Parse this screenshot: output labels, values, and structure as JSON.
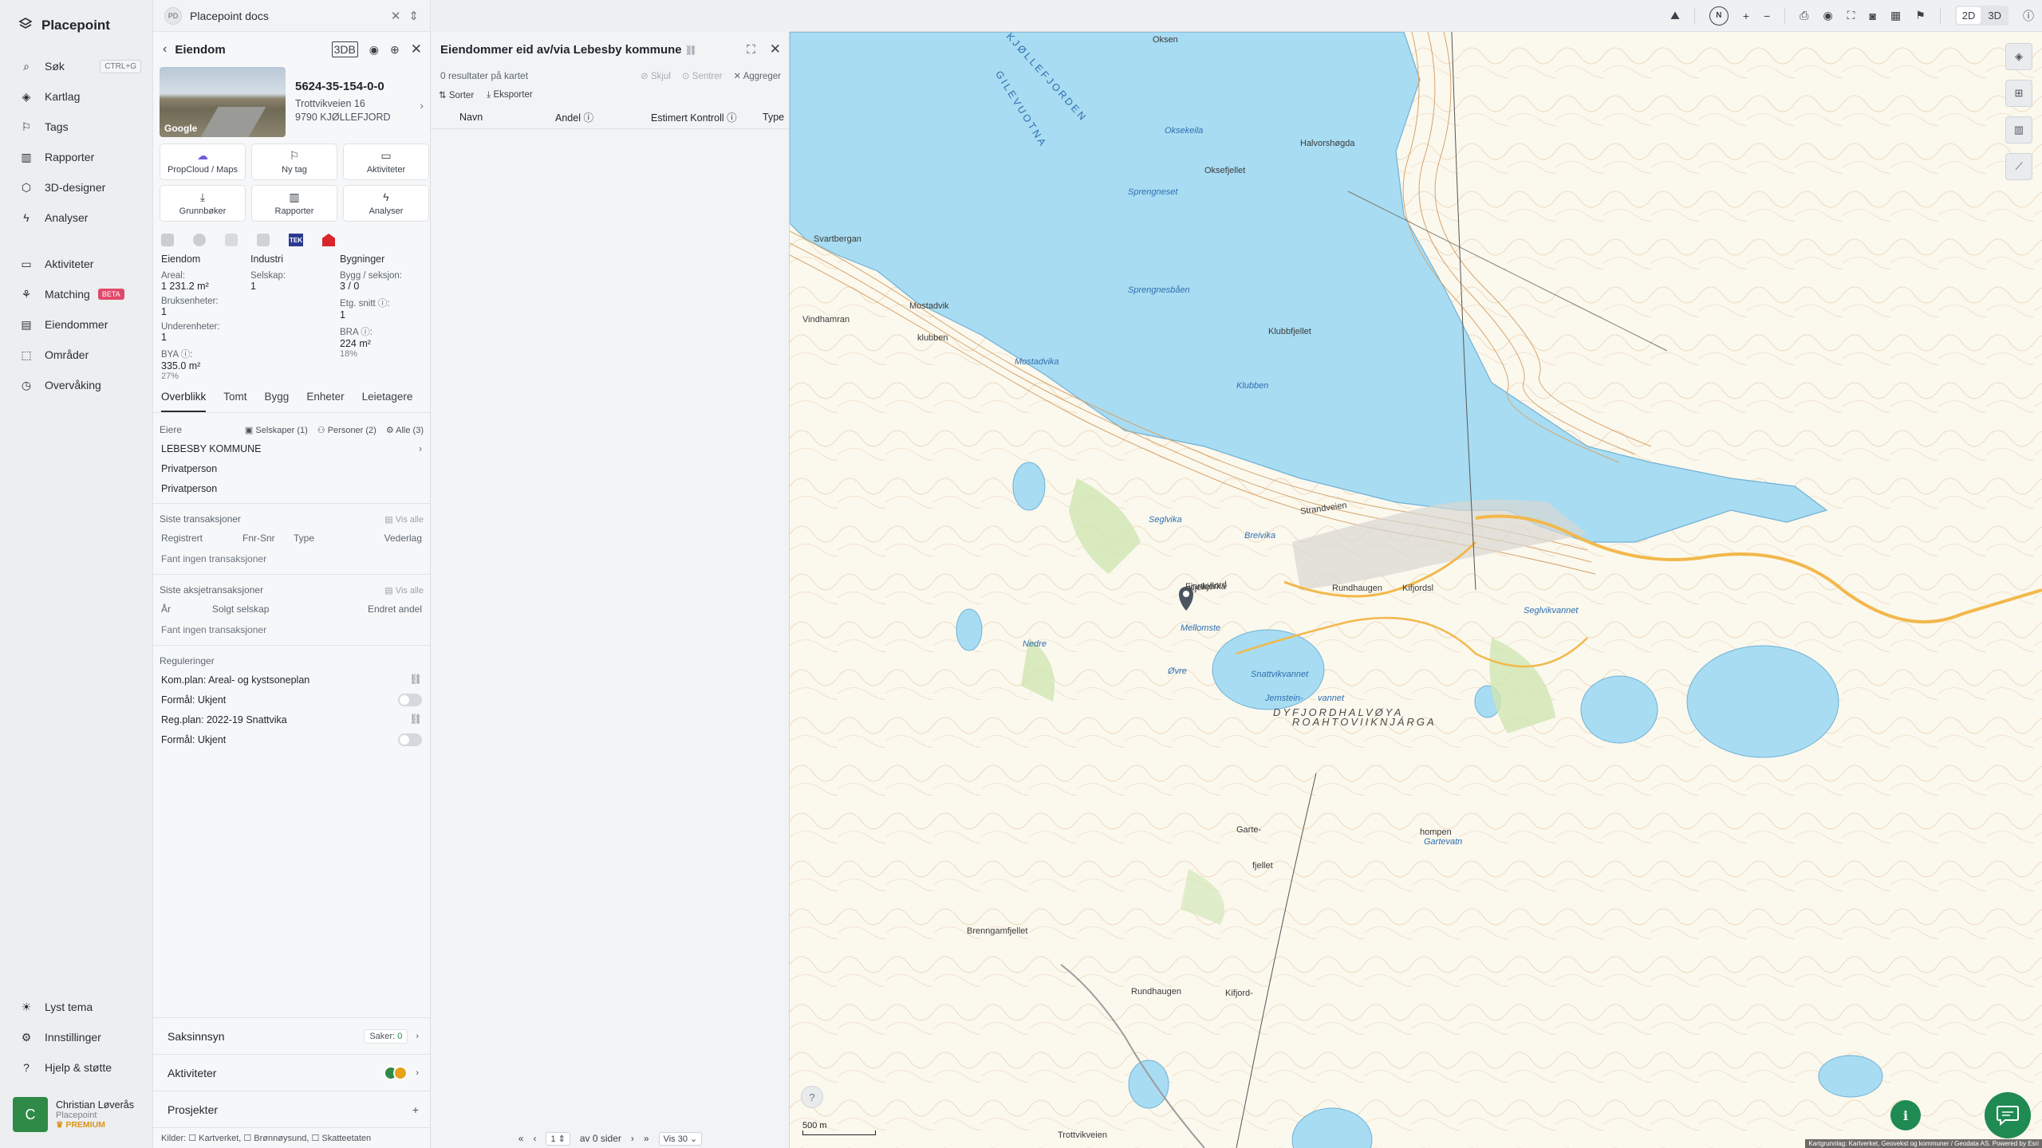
{
  "app": {
    "brand": "Placepoint"
  },
  "nav": {
    "items": [
      {
        "label": "Søk",
        "shortcut": "CTRL+G",
        "icon": "search-icon"
      },
      {
        "label": "Kartlag",
        "icon": "layers-icon"
      },
      {
        "label": "Tags",
        "icon": "bookmark-icon"
      },
      {
        "label": "Rapporter",
        "icon": "chart-icon"
      },
      {
        "label": "3D-designer",
        "icon": "cube-icon"
      },
      {
        "label": "Analyser",
        "icon": "bolt-icon"
      }
    ],
    "items2": [
      {
        "label": "Aktiviteter",
        "icon": "chat-icon"
      },
      {
        "label": "Matching",
        "badge": "BETA",
        "icon": "handshake-icon"
      },
      {
        "label": "Eiendommer",
        "icon": "book-icon"
      },
      {
        "label": "Områder",
        "icon": "area-icon"
      },
      {
        "label": "Overvåking",
        "icon": "clock-icon"
      }
    ],
    "bottom": [
      {
        "label": "Lyst tema",
        "icon": "sun-icon"
      },
      {
        "label": "Innstillinger",
        "icon": "gear-icon"
      },
      {
        "label": "Hjelp & støtte",
        "icon": "help-icon"
      }
    ],
    "user": {
      "initial": "C",
      "name": "Christian Løverås",
      "org": "Placepoint",
      "tier": "PREMIUM"
    }
  },
  "tab": {
    "badge": "PD",
    "title": "Placepoint docs"
  },
  "eiendom": {
    "title": "Eiendom",
    "badge_3d": "3DB",
    "id": "5624-35-154-0-0",
    "address1": "Trottvikveien 16",
    "address2": "9790 KJØLLEFJORD",
    "street_view_label": "Google",
    "actions": [
      {
        "label": "PropCloud / Maps",
        "icon": "cloud-icon"
      },
      {
        "label": "Ny tag",
        "icon": "bookmark-icon"
      },
      {
        "label": "Aktiviteter",
        "icon": "chat-icon"
      },
      {
        "label": "Grunnbøker",
        "icon": "download-icon"
      },
      {
        "label": "Rapporter",
        "icon": "chart-icon"
      },
      {
        "label": "Analyser",
        "icon": "bolt-icon"
      }
    ],
    "source_tek": "TEK",
    "stats": {
      "col1_head": "Eiendom",
      "col2_head": "Industri",
      "col3_head": "Bygninger",
      "areal_label": "Areal:",
      "areal_value": "1 231.2 m²",
      "bruksenheter_label": "Bruksenheter:",
      "bruksenheter_value": "1",
      "underenheter_label": "Underenheter:",
      "underenheter_value": "1",
      "bya_label": "BYA ⓘ:",
      "bya_value": "335.0 m²",
      "bya_pct": "27%",
      "selskap_label": "Selskap:",
      "selskap_value": "1",
      "bygg_label": "Bygg / seksjon:",
      "bygg_value": "3 / 0",
      "etg_label": "Etg. snitt ⓘ:",
      "etg_value": "1",
      "bra_label": "BRA ⓘ:",
      "bra_value": "224 m²",
      "bra_pct": "18%"
    },
    "subtabs": [
      "Overblikk",
      "Tomt",
      "Bygg",
      "Enheter",
      "Leietagere"
    ],
    "owners": {
      "label": "Eiere",
      "filters": [
        "Selskaper (1)",
        "Personer (2)",
        "Alle (3)"
      ],
      "list": [
        "LEBESBY KOMMUNE",
        "Privatperson",
        "Privatperson"
      ]
    },
    "transactions": {
      "label": "Siste transaksjoner",
      "show_all": "Vis alle",
      "cols": [
        "Registrert",
        "Fnr-Snr",
        "Type",
        "Vederlag"
      ],
      "empty": "Fant ingen transaksjoner"
    },
    "share_transactions": {
      "label": "Siste aksjetransaksjoner",
      "show_all": "Vis alle",
      "cols": [
        "År",
        "Solgt selskap",
        "Endret andel"
      ],
      "empty": "Fant ingen transaksjoner"
    },
    "regulations": {
      "label": "Reguleringer",
      "rows": [
        "Kom.plan: Areal- og kystsoneplan",
        "Formål: Ukjent",
        "Reg.plan: 2022-19 Snattvika",
        "Formål: Ukjent"
      ]
    },
    "footer": {
      "saksinnsyn": "Saksinnsyn",
      "saker_label": "Saker:",
      "saker_value": "0",
      "aktiviteter": "Aktiviteter",
      "prosjekter": "Prosjekter",
      "kilder": "Kilder: ☐ Kartverket, ☐ Brønnøysund, ☐ Skatteetaten"
    }
  },
  "owned": {
    "title": "Eiendommer eid av/via Lebesby kommune",
    "results": "0 resultater på kartet",
    "skjul": "Skjul",
    "sentrer": "Sentrer",
    "aggreger": "Aggreger",
    "sorter": "Sorter",
    "eksporter": "Eksporter",
    "cols": [
      "Navn",
      "Andel ⓘ",
      "Estimert Kontroll ⓘ",
      "Type"
    ],
    "pager": {
      "page": "1",
      "of": "av 0 sider",
      "per_page": "Vis 30"
    }
  },
  "map": {
    "toolbar": {
      "north": "N",
      "mode_2d": "2D",
      "mode_3d": "3D"
    },
    "scale": "500 m",
    "attribution": "Kartgrunnlag: Kartverket, Geovekst og kommuner / Geodata AS. Powered by Esri",
    "labels": [
      {
        "text": "Oksen",
        "cls": ""
      },
      {
        "text": "KJØLLEFJORDEN",
        "cls": "fjord"
      },
      {
        "text": "GILEVUOTNA",
        "cls": "fjord"
      },
      {
        "text": "Oksekeila",
        "cls": "water"
      },
      {
        "text": "Oksefjellet",
        "cls": ""
      },
      {
        "text": "Halvorshøgda",
        "cls": ""
      },
      {
        "text": "Sprengneset",
        "cls": "water"
      },
      {
        "text": "Sprengnesbåen",
        "cls": "water"
      },
      {
        "text": "Svartbergan",
        "cls": ""
      },
      {
        "text": "Vindhamran",
        "cls": ""
      },
      {
        "text": "Mostadvik",
        "cls": ""
      },
      {
        "text": "klubben",
        "cls": ""
      },
      {
        "text": "Mostadvika",
        "cls": "water"
      },
      {
        "text": "Klubbfjellet",
        "cls": ""
      },
      {
        "text": "Klubben",
        "cls": "water"
      },
      {
        "text": "Seglvika",
        "cls": "water"
      },
      {
        "text": "Breivika",
        "cls": "water"
      },
      {
        "text": "Strandveien",
        "cls": ""
      },
      {
        "text": "Kjelleflord",
        "cls": ""
      },
      {
        "text": "Rundhaugen",
        "cls": ""
      },
      {
        "text": "Kifjordsl",
        "cls": ""
      },
      {
        "text": "Seglvikvannet",
        "cls": "water"
      },
      {
        "text": "Nedre",
        "cls": "water"
      },
      {
        "text": "Mellomste",
        "cls": "water"
      },
      {
        "text": "Øvre",
        "cls": "water"
      },
      {
        "text": "Snattvikvannet",
        "cls": "water"
      },
      {
        "text": "Jemstein-",
        "cls": "water"
      },
      {
        "text": "vannet",
        "cls": "water"
      },
      {
        "text": "DYFJORDHALVØYA",
        "cls": "big"
      },
      {
        "text": "ROAHTOVIIKNJÁRGA",
        "cls": "big"
      },
      {
        "text": "Garte-",
        "cls": ""
      },
      {
        "text": "fjellet",
        "cls": ""
      },
      {
        "text": "Rundhaugen",
        "cls": ""
      },
      {
        "text": "Kifjord-",
        "cls": ""
      },
      {
        "text": "hompen",
        "cls": ""
      },
      {
        "text": "Gartevatn",
        "cls": "water"
      },
      {
        "text": "Brenngamfjellet",
        "cls": ""
      },
      {
        "text": "Trottvikveien",
        "cls": ""
      },
      {
        "text": "Finnkjerka",
        "cls": ""
      }
    ]
  }
}
